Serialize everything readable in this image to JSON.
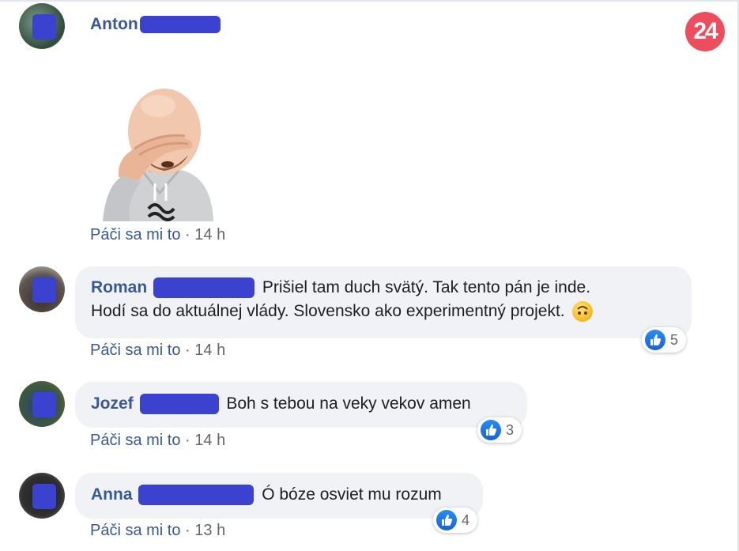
{
  "badge": {
    "label": "24",
    "color": "#ee4d5d"
  },
  "accent_color": "#385898",
  "comments": [
    {
      "author": "Anton",
      "text": "",
      "attachment": "facepalm-sticker",
      "like_label": "Páči sa mi to",
      "separator": "·",
      "time": "14 h",
      "reactions": null
    },
    {
      "author": "Roman",
      "text_line1": "Prišiel tam duch svätý. Tak tento pán je inde.",
      "text_line2": "Hodí sa do aktuálnej vlády. Slovensko ako experimentný projekt.",
      "emoji": "upside-down-face",
      "like_label": "Páči sa mi to",
      "separator": "·",
      "time": "14 h",
      "reactions": "5"
    },
    {
      "author": "Jozef",
      "text": "Boh s tebou na veky vekov amen",
      "like_label": "Páči sa mi to",
      "separator": "·",
      "time": "14 h",
      "reactions": "3"
    },
    {
      "author": "Anna",
      "text": "Ó bóze osviet mu rozum",
      "like_label": "Páči sa mi to",
      "separator": "·",
      "time": "13 h",
      "reactions": "4"
    }
  ]
}
